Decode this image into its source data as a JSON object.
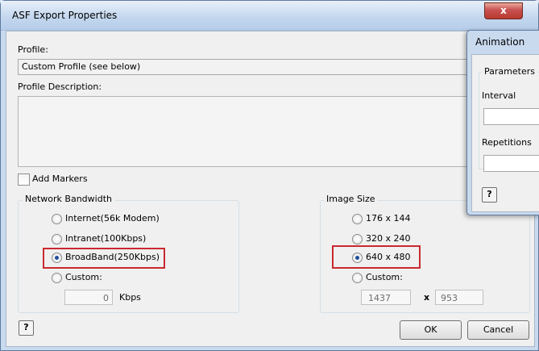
{
  "dialog": {
    "title": "ASF Export Properties",
    "close_symbol": "x",
    "profile_label": "Profile:",
    "profile_value": "Custom Profile (see below)",
    "profile_description_label": "Profile Description:",
    "add_markers_label": "Add Markers",
    "network_bandwidth": {
      "title": "Network Bandwidth",
      "options": [
        "Internet(56k Modem)",
        "Intranet(100Kbps)",
        "BroadBand(250Kbps)",
        "Custom:"
      ],
      "selected": "BroadBand(250Kbps)",
      "custom_value": "0",
      "unit": "Kbps"
    },
    "image_size": {
      "title": "Image Size",
      "options": [
        "176 x 144",
        "320 x 240",
        "640 x 480",
        "Custom:"
      ],
      "selected": "640 x 480",
      "custom_width": "1437",
      "separator": "x",
      "custom_height": "953"
    },
    "help_symbol": "?",
    "ok_label": "OK",
    "cancel_label": "Cancel"
  },
  "animation": {
    "title": "Animation",
    "parameters_label": "Parameters",
    "interval_label": "Interval",
    "interval_value": "",
    "repetitions_label": "Repetitions",
    "repetitions_value": "",
    "help_symbol": "?"
  },
  "colors": {
    "highlight_border": "#c9292f",
    "title_bar": "#c2d6ee",
    "close_button": "#c75050"
  }
}
